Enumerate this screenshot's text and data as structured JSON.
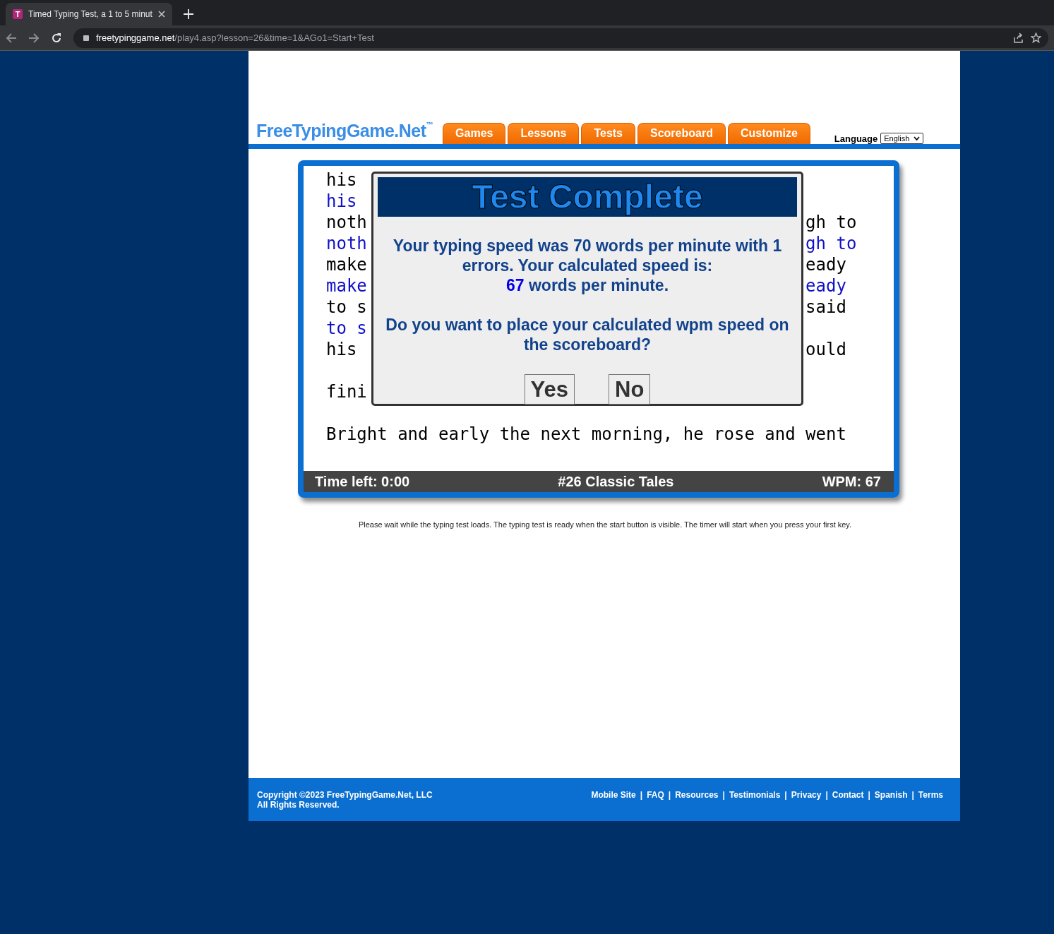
{
  "browser": {
    "favicon_letter": "T",
    "tab_title": "Timed Typing Test, a 1 to 5 minut",
    "url_host": "freetypinggame.net",
    "url_path": "/play4.asp?lesson=26&time=1&AGo1=Start+Test"
  },
  "header": {
    "logo": "FreeTypingGame.Net",
    "logo_mark": "™",
    "nav": [
      {
        "label": "Games"
      },
      {
        "label": "Lessons"
      },
      {
        "label": "Tests"
      },
      {
        "label": "Scoreboard"
      },
      {
        "label": "Customize"
      }
    ],
    "language_label": "Language",
    "language_value": "English"
  },
  "typing": {
    "lines": [
      {
        "kind": "text",
        "left": "his",
        "typed": false
      },
      {
        "kind": "text",
        "left": "his",
        "typed": true
      },
      {
        "kind": "text",
        "left": "noth",
        "right": "gh to",
        "typed": false
      },
      {
        "kind": "text",
        "left": "noth",
        "right": "gh to",
        "typed": true
      },
      {
        "kind": "text",
        "left": "make",
        "right": "eady",
        "typed": false
      },
      {
        "kind": "text",
        "left": "make",
        "right": "eady",
        "typed": true
      },
      {
        "kind": "text",
        "left": "to s",
        "right": "said",
        "typed": false
      },
      {
        "kind": "text",
        "left": "to s",
        "typed": true
      },
      {
        "kind": "text",
        "left": "his",
        "right": "ould",
        "typed": false
      },
      {
        "kind": "blank"
      },
      {
        "kind": "text",
        "left": "fini",
        "typed": false
      },
      {
        "kind": "blank"
      },
      {
        "kind": "text",
        "left": "Bright and early the next morning, he rose and went",
        "typed": false
      }
    ],
    "status": {
      "time_left": "Time left: 0:00",
      "lesson": "#26 Classic Tales",
      "wpm": "WPM: 67"
    }
  },
  "dialog": {
    "title": "Test Complete",
    "result": "Your typing speed was 70 words per minute with 1 errors. Your calculated speed is:",
    "speed_value": "67",
    "speed_unit": "words per minute.",
    "question": "Do you want to place your calculated wpm speed on the scoreboard?",
    "buttons": [
      "Yes",
      "No"
    ]
  },
  "note": "Please wait while the typing test loads. The typing test is ready when the start button is visible. The timer will start when you press your first key.",
  "footer": {
    "copyright": [
      "Copyright ©2023 FreeTypingGame.Net, LLC",
      "All Rights Reserved."
    ],
    "links": [
      "Mobile Site",
      "FAQ",
      "Resources",
      "Testimonials",
      "Privacy",
      "Contact",
      "Spanish",
      "Terms"
    ],
    "separator": "|"
  }
}
